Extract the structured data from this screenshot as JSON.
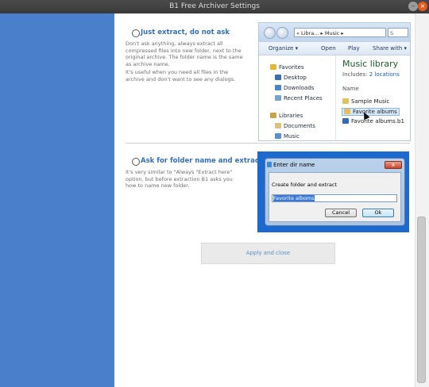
{
  "window": {
    "title": "B1 Free Archiver Settings",
    "minimize_glyph": "–",
    "close_glyph": "×"
  },
  "options": [
    {
      "title": "Just extract, do not ask",
      "desc1": "Don't ask anything, always extract all compressed files into new folder, next to the original archive. The folder name is the same as archive name.",
      "desc2": "It's useful when you need all files in the archive and don't want to see any dialogs."
    },
    {
      "title": "Ask for folder name and extract",
      "desc1": "It's very similar to \"Always \"Extract here\" option, but before extraction B1 asks you how to name new folder."
    }
  ],
  "explorer": {
    "address": "« Libra... ▸ Music ▸",
    "search_glyph": "S",
    "toolbar": {
      "organize": "Organize ▾",
      "open": "Open",
      "play": "Play",
      "share": "Share with ▾"
    },
    "nav": {
      "favorites": "Favorites",
      "desktop": "Desktop",
      "downloads": "Downloads",
      "recent": "Recent Places",
      "libraries": "Libraries",
      "documents": "Documents",
      "music": "Music"
    },
    "library_title": "Music library",
    "includes_label": "Includes:",
    "includes_link": "2 locations",
    "name_header": "Name",
    "files": [
      "Sample Music",
      "Favorite albums",
      "Favorite albums.b1"
    ]
  },
  "dialog": {
    "title": "Enter dir name",
    "close_glyph": "x",
    "label": "Create folder and extract",
    "input_value": "Favorite alboms",
    "cancel": "Cancel",
    "ok": "Ok"
  },
  "apply_button": "Apply and close",
  "colors": {
    "sidebar": "#4a7fcc",
    "accent_text": "#3370b6",
    "dialog_frame": "#1c6ad0"
  }
}
